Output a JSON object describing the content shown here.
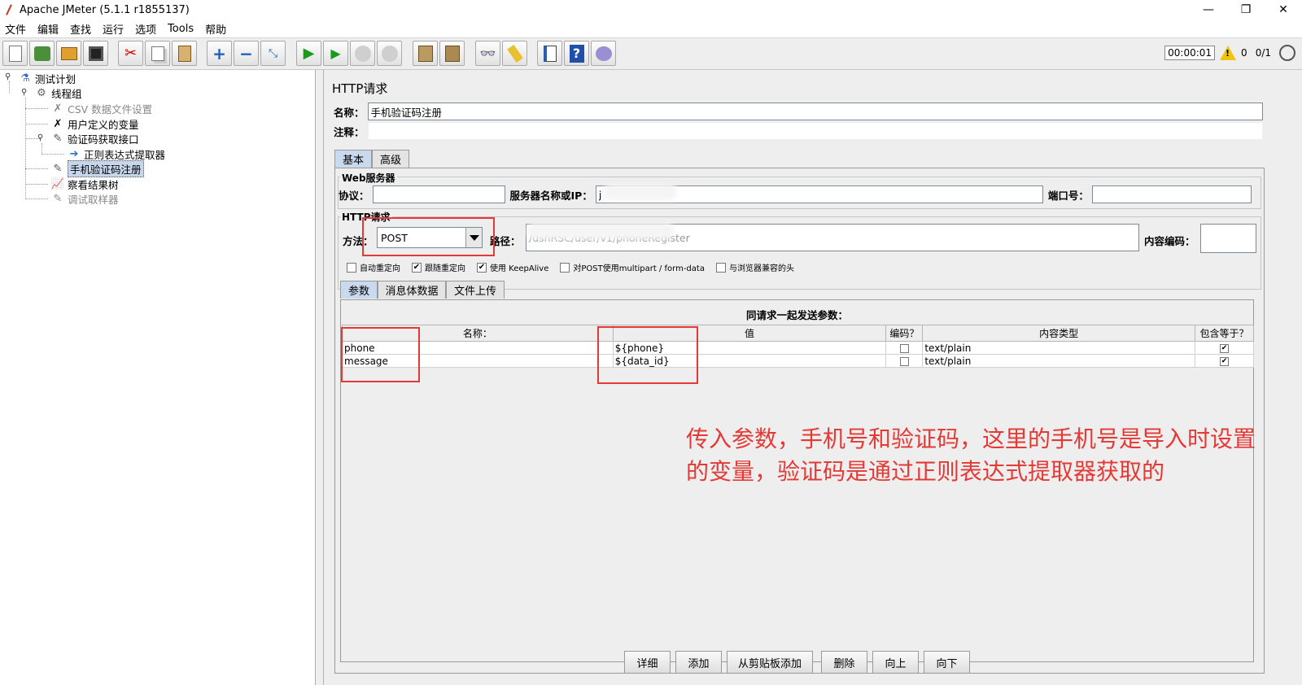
{
  "window": {
    "title": "Apache JMeter (5.1.1 r1855137)",
    "minimize": "—",
    "maximize": "❐",
    "close": "✕"
  },
  "menu": [
    "文件",
    "编辑",
    "查找",
    "运行",
    "选项",
    "Tools",
    "帮助"
  ],
  "toolbar": {
    "timer": "00:00:01",
    "warn_count": "0",
    "thread_count": "0/1",
    "icons": [
      "new-icon",
      "templates-icon",
      "open-icon",
      "save-icon",
      "cut-icon",
      "copy-icon",
      "paste-icon",
      "expand-icon",
      "collapse-icon",
      "toggle-icon",
      "start-icon",
      "start-no-pause-icon",
      "stop-icon",
      "shutdown-icon",
      "clear-icon",
      "clear-all-icon",
      "search-icon",
      "reset-search-icon",
      "function-helper-icon",
      "help-icon",
      "remote-icon"
    ]
  },
  "tree": {
    "items": [
      {
        "label": "测试计划"
      },
      {
        "label": "线程组"
      },
      {
        "label": "CSV 数据文件设置"
      },
      {
        "label": "用户定义的变量"
      },
      {
        "label": "验证码获取接口"
      },
      {
        "label": "正则表达式提取器"
      },
      {
        "label": "手机验证码注册"
      },
      {
        "label": "察看结果树"
      },
      {
        "label": "调试取样器"
      }
    ]
  },
  "panel": {
    "title": "HTTP请求",
    "name_label": "名称：",
    "name_value": "手机验证码注册",
    "comment_label": "注释：",
    "tabs": [
      "基本",
      "高级"
    ],
    "web_server": {
      "group_title": "Web服务器",
      "protocol_label": "协议：",
      "server_label": "服务器名称或IP：",
      "server_value": "j",
      "port_label": "端口号："
    },
    "http_request": {
      "group_title": "HTTP请求",
      "method_label": "方法：",
      "method_value": "POST",
      "path_label": "路径：",
      "path_value": "/dshRSC/user/v1/phoneRegister",
      "encoding_label": "内容编码："
    },
    "options": [
      {
        "label": "自动重定向",
        "checked": false
      },
      {
        "label": "跟随重定向",
        "checked": true
      },
      {
        "label": "使用 KeepAlive",
        "checked": true
      },
      {
        "label": "对POST使用multipart / form-data",
        "checked": false
      },
      {
        "label": "与浏览器兼容的头",
        "checked": false
      }
    ],
    "subtabs": [
      "参数",
      "消息体数据",
      "文件上传"
    ],
    "params_caption": "同请求一起发送参数：",
    "columns": [
      "名称：",
      "值",
      "编码？",
      "内容类型",
      "包含等于？"
    ],
    "rows": [
      {
        "name": "phone",
        "value": "${phone}",
        "encode": false,
        "content_type": "text/plain",
        "include_equals": true
      },
      {
        "name": "message",
        "value": "${data_id}",
        "encode": false,
        "content_type": "text/plain",
        "include_equals": true
      }
    ],
    "buttons": [
      "详细",
      "添加",
      "从剪贴板添加",
      "删除",
      "向上",
      "向下"
    ]
  },
  "annotation": {
    "line1": "传入参数，手机号和验证码，这里的手机号是导入时设置",
    "line2": "的变量，验证码是通过正则表达式提取器获取的",
    "color": "#e53935"
  }
}
